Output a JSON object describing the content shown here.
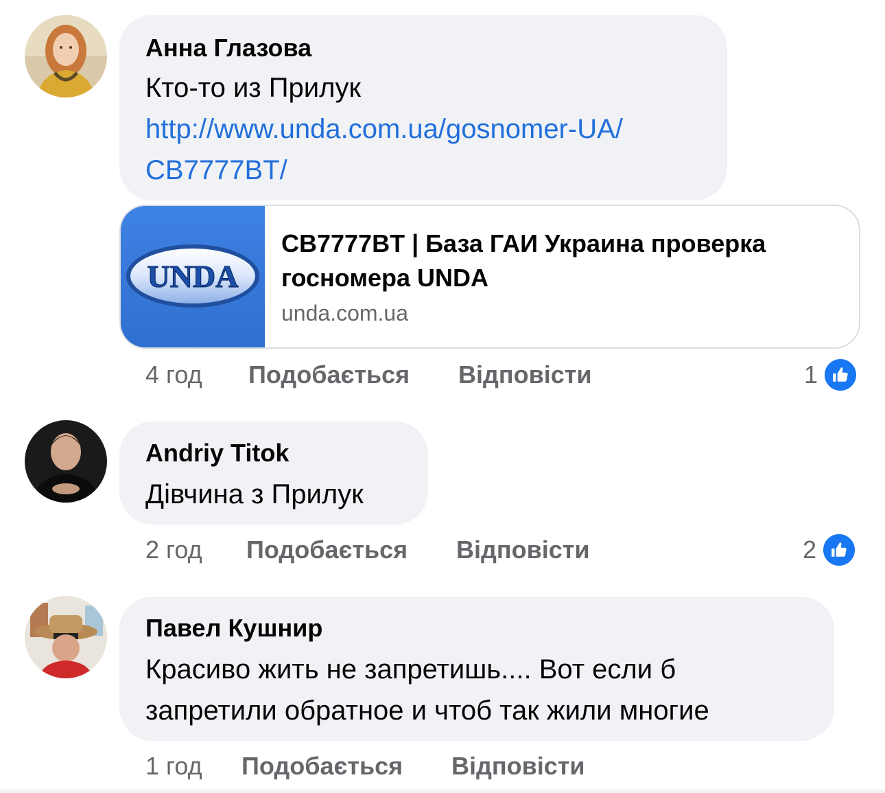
{
  "comments": [
    {
      "author": "Анна Глазова",
      "text": "Кто-то из Прилук",
      "link_line1": "http://www.unda.com.ua/gosnomer-UA/",
      "link_line2": "CB7777BT/",
      "preview": {
        "logo_text": "UNDA",
        "title": "CB7777BT | База ГАИ Украина проверка госномера UNDA",
        "domain": "unda.com.ua"
      },
      "time": "4 год",
      "like_label": "Подобається",
      "reply_label": "Відповісти",
      "reaction_count": "1",
      "reaction_icon": "like-icon"
    },
    {
      "author": "Andriy Titok",
      "text": "Дівчина з Прилук",
      "time": "2 год",
      "like_label": "Подобається",
      "reply_label": "Відповісти",
      "reaction_count": "2",
      "reaction_icon": "like-icon"
    },
    {
      "author": "Павел Кушнир",
      "text_line1": "Красиво жить не запретишь.... Вот если б",
      "text_line2": "запретили обратное и чтоб так жили многие",
      "time": "1 год",
      "like_label": "Подобається",
      "reply_label": "Відповісти"
    }
  ],
  "colors": {
    "bubble": "#f0f2f5",
    "link": "#216fdb",
    "meta": "#65676b",
    "like": "#1877f2"
  }
}
